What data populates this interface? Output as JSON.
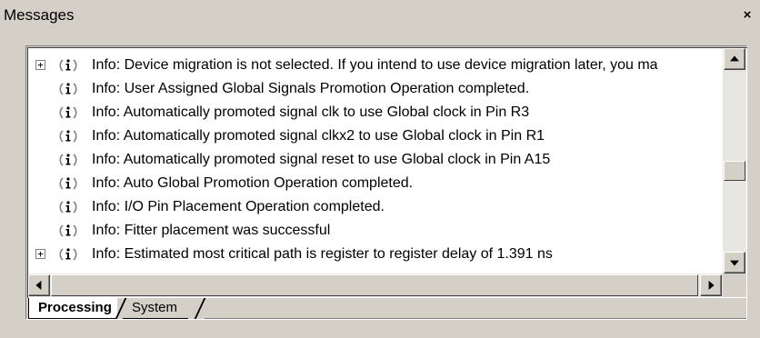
{
  "window": {
    "title": "Messages",
    "close_symbol": "×"
  },
  "messages": [
    {
      "expandable": true,
      "expander": "+",
      "icon": "info-icon",
      "text": "Info: Device migration is not selected. If you intend to use device migration later, you ma"
    },
    {
      "expandable": false,
      "icon": "info-icon",
      "text": "Info: User Assigned Global Signals Promotion Operation completed."
    },
    {
      "expandable": false,
      "icon": "info-icon",
      "text": "Info: Automatically promoted signal clk to use Global clock in Pin R3"
    },
    {
      "expandable": false,
      "icon": "info-icon",
      "text": "Info: Automatically promoted signal clkx2 to use Global clock in Pin R1"
    },
    {
      "expandable": false,
      "icon": "info-icon",
      "text": "Info: Automatically promoted signal reset to use Global clock in Pin A15"
    },
    {
      "expandable": false,
      "icon": "info-icon",
      "text": "Info: Auto Global Promotion Operation completed."
    },
    {
      "expandable": false,
      "icon": "info-icon",
      "text": "Info: I/O Pin Placement Operation completed."
    },
    {
      "expandable": false,
      "icon": "info-icon",
      "text": "Info: Fitter placement was successful"
    },
    {
      "expandable": true,
      "expander": "+",
      "icon": "info-icon",
      "text": "Info: Estimated most critical path is register to register delay of 1.391 ns"
    }
  ],
  "tabs": [
    {
      "label": "Processing",
      "active": true
    },
    {
      "label": "System",
      "active": false
    }
  ],
  "colors": {
    "chrome": "#d4d0c8",
    "list_background": "#ffffff",
    "info_icon_ring": "#808080"
  }
}
